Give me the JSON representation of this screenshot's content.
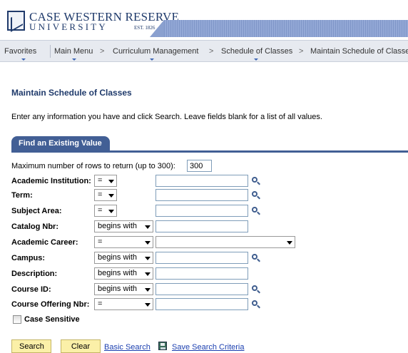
{
  "logo": {
    "name_line1": "CASE WESTERN RESERVE",
    "name_line2": "UNIVERSITY",
    "est": "EST. 1826"
  },
  "breadcrumb": {
    "favorites": "Favorites",
    "main_menu": "Main Menu",
    "curriculum": "Curriculum Management",
    "schedule": "Schedule of Classes",
    "maintain": "Maintain Schedule of Classe",
    "separator": ">"
  },
  "page": {
    "title": "Maintain Schedule of Classes",
    "instructions": "Enter any information you have and click Search. Leave fields blank for a list of all values.",
    "tab_label": "Find an Existing Value"
  },
  "form": {
    "max_rows_label": "Maximum number of rows to return (up to 300):",
    "max_rows_value": "300",
    "fields": [
      {
        "label": "Academic Institution:",
        "operator": "=",
        "value": "",
        "lookup": true
      },
      {
        "label": "Term:",
        "operator": "=",
        "value": "",
        "lookup": true
      },
      {
        "label": "Subject Area:",
        "operator": "=",
        "value": "",
        "lookup": true
      },
      {
        "label": "Catalog Nbr:",
        "operator": "begins with",
        "value": "",
        "lookup": false
      },
      {
        "label": "Academic Career:",
        "operator": "=",
        "value": "",
        "lookup": false
      },
      {
        "label": "Campus:",
        "operator": "begins with",
        "value": "",
        "lookup": true
      },
      {
        "label": "Description:",
        "operator": "begins with",
        "value": "",
        "lookup": false
      },
      {
        "label": "Course ID:",
        "operator": "begins with",
        "value": "",
        "lookup": true
      },
      {
        "label": "Course Offering Nbr:",
        "operator": "=",
        "value": "",
        "lookup": true
      }
    ],
    "case_sensitive_label": "Case Sensitive",
    "case_sensitive_checked": false
  },
  "actions": {
    "search": "Search",
    "clear": "Clear",
    "basic_search": "Basic Search",
    "save_search": "Save Search Criteria"
  },
  "colors": {
    "brand_navy": "#1f3a6b",
    "tab_blue": "#425f95",
    "button_yellow": "#fbf0a8",
    "link_blue": "#1b3fb0"
  }
}
